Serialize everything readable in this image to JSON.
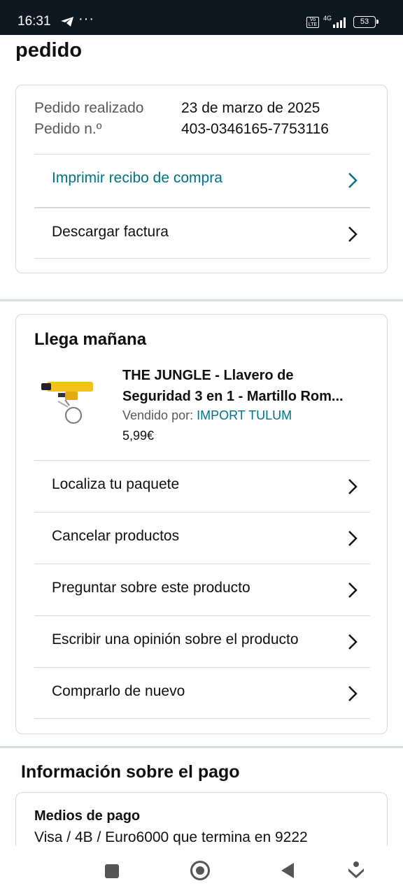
{
  "status_bar": {
    "time": "16:31",
    "dots": "···",
    "volte": "Vo LTE",
    "network": "4G",
    "battery": "53"
  },
  "page": {
    "title": "pedido"
  },
  "order_card": {
    "placed_label": "Pedido realizado",
    "placed_value": "23 de marzo de 2025",
    "number_label": "Pedido n.º",
    "number_value": "403-0346165-7753116",
    "rows": [
      {
        "label": "Imprimir recibo de compra"
      },
      {
        "label": "Descargar factura"
      }
    ]
  },
  "delivery_card": {
    "title": "Llega mañana",
    "product": {
      "title_line1": "THE JUNGLE - Llavero de",
      "title_line2": "Seguridad 3 en 1 - Martillo Rom...",
      "sold_by_label": "Vendido por:",
      "seller": "IMPORT TULUM",
      "price": "5,99€"
    },
    "rows": [
      {
        "label": "Localiza tu paquete"
      },
      {
        "label": "Cancelar productos"
      },
      {
        "label": "Preguntar sobre este producto"
      },
      {
        "label": "Escribir una opinión sobre el producto"
      },
      {
        "label": "Comprarlo de nuevo"
      }
    ]
  },
  "payment": {
    "heading": "Información sobre el pago",
    "subheading": "Medios de pago",
    "method": "Visa / 4B / Euro6000  que termina en 9222"
  },
  "colors": {
    "link": "#007185",
    "text": "#0f1111",
    "muted": "#565959",
    "border": "#d5d9d9"
  },
  "icons": [
    "telegram-icon",
    "chevron-right-icon",
    "nav-recents-icon",
    "nav-home-icon",
    "nav-back-icon",
    "nav-download-icon"
  ]
}
